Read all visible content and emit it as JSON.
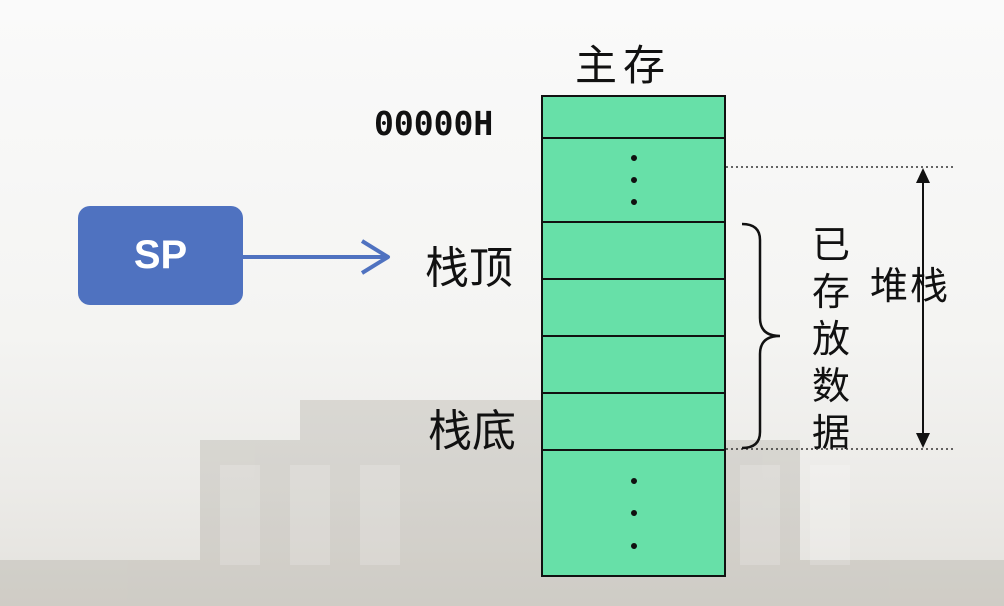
{
  "diagram": {
    "title": "主存",
    "start_address": "00000H",
    "pointer": "SP",
    "stack_top_label": "栈顶",
    "stack_bottom_label": "栈底",
    "stored_data_label": "已存放数据",
    "stack_label": "堆栈",
    "colors": {
      "cell_fill": "#67e0a8",
      "pointer_fill": "#4f72c0",
      "arrow": "#4f72c0"
    }
  }
}
